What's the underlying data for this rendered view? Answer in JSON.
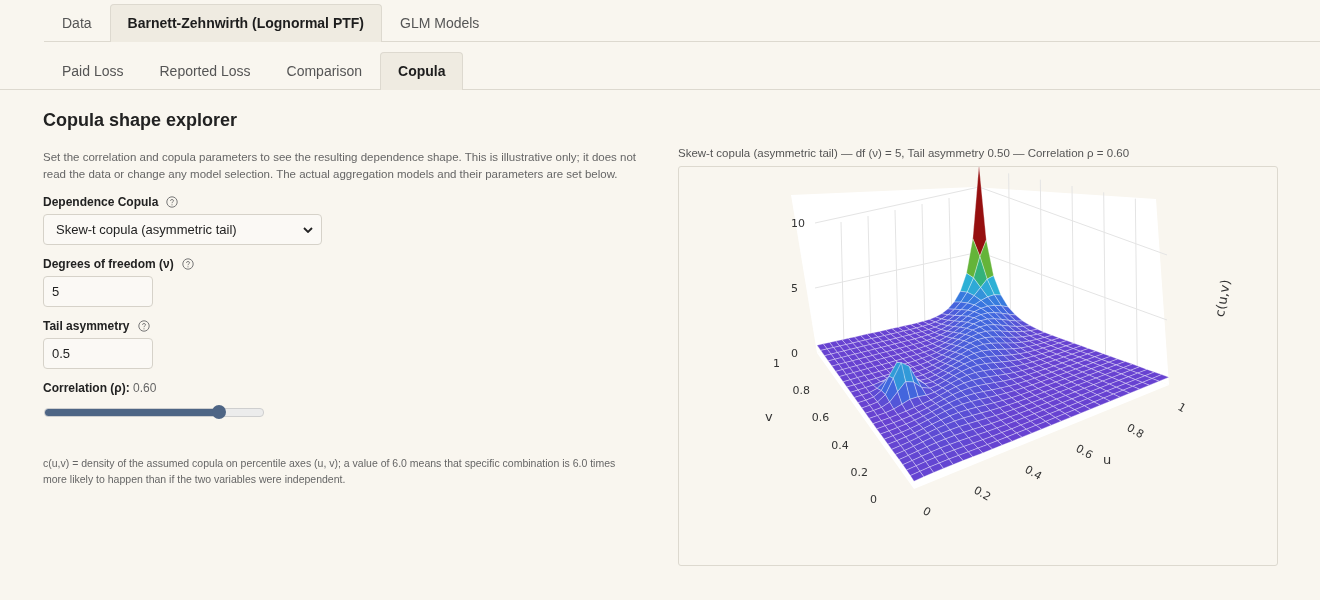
{
  "tabs": [
    {
      "label": "Data",
      "selected": false
    },
    {
      "label": "Barnett-Zehnwirth (Lognormal PTF)",
      "selected": true
    },
    {
      "label": "GLM Models",
      "selected": false
    }
  ],
  "subtabs": [
    {
      "label": "Paid Loss",
      "selected": false
    },
    {
      "label": "Reported Loss",
      "selected": false
    },
    {
      "label": "Comparison",
      "selected": false
    },
    {
      "label": "Copula",
      "selected": true
    }
  ],
  "heading": "Copula shape explorer",
  "intro": "Set the correlation and copula parameters to see the resulting dependence shape. This is illustrative only; it does not read the data or change any model selection. The actual aggregation models and their parameters are set below.",
  "fields": [
    {
      "kind": "select",
      "label": "Dependence Copula",
      "help": true,
      "value": "Skew-t copula (asymmetric tail)"
    },
    {
      "kind": "number",
      "label": "Degrees of freedom (ν)",
      "help": true,
      "value": "5"
    },
    {
      "kind": "number",
      "label": "Tail asymmetry",
      "help": true,
      "value": "0.5"
    }
  ],
  "correlation": {
    "label": "Correlation (ρ):",
    "reading": "0.60",
    "level": 0.8
  },
  "footnote": "c(u,v) = density of the assumed copula on percentile axes (u, v); a value of 6.0 means that specific combination is 6.0 times more likely to happen than if the two variables were independent.",
  "plot": {
    "title": "Skew-t copula (asymmetric tail) — df (ν) = 5, Tail asymmetry 0.50 — Correlation ρ = 0.60",
    "z_label": "c(u,v)",
    "u_label": "u",
    "v_label": "v",
    "z_ticks": [
      "10",
      "5",
      "0"
    ],
    "u_ticks": [
      "0",
      "0.2",
      "0.4",
      "0.6",
      "0.8",
      "1"
    ],
    "v_ticks": [
      "0",
      "0.2",
      "0.4",
      "0.6",
      "0.8",
      "1"
    ]
  }
}
